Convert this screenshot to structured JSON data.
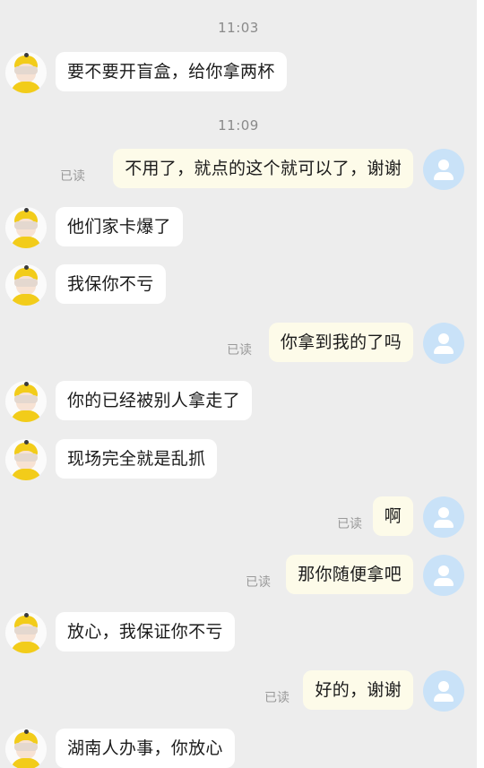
{
  "timestamps": [
    "11:03",
    "11:09"
  ],
  "read_label": "已读",
  "colors": {
    "background": "#ededed",
    "incoming_bubble": "#ffffff",
    "outgoing_bubble": "#fdfbe9",
    "self_avatar": "#c9e2f8",
    "contact_avatar_accent": "#f2cc1a"
  },
  "messages": [
    {
      "side": "left",
      "text": "要不要开盲盒，给你拿两杯"
    },
    {
      "side": "right",
      "text": "不用了，就点的这个就可以了，谢谢",
      "read": true
    },
    {
      "side": "left",
      "text": "他们家卡爆了"
    },
    {
      "side": "left",
      "text": "我保你不亏"
    },
    {
      "side": "right",
      "text": "你拿到我的了吗",
      "read": true
    },
    {
      "side": "left",
      "text": "你的已经被别人拿走了"
    },
    {
      "side": "left",
      "text": "现场完全就是乱抓"
    },
    {
      "side": "right",
      "text": "啊",
      "read": true
    },
    {
      "side": "right",
      "text": "那你随便拿吧",
      "read": true
    },
    {
      "side": "left",
      "text": "放心，我保证你不亏"
    },
    {
      "side": "right",
      "text": "好的，谢谢",
      "read": true
    },
    {
      "side": "left",
      "text": "湖南人办事，你放心"
    }
  ]
}
